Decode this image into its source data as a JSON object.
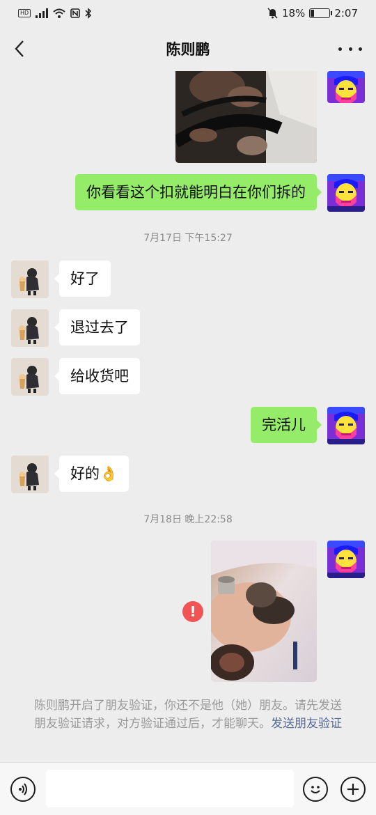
{
  "status_bar": {
    "battery": "18%",
    "time": "2:07",
    "hd": "HD"
  },
  "header": {
    "title": "陈则鹏"
  },
  "messages": [
    {
      "side": "out",
      "text": "你看看这个扣就能明白在你们拆的"
    },
    {
      "timestamp": "7月17日 下午15:27"
    },
    {
      "side": "in",
      "text": "好了"
    },
    {
      "side": "in",
      "text": "退过去了"
    },
    {
      "side": "in",
      "text": "给收货吧"
    },
    {
      "side": "out",
      "text": "完活儿"
    },
    {
      "side": "in",
      "text": "好的👌"
    },
    {
      "timestamp": "7月18日 晚上22:58"
    }
  ],
  "error_mark": "!",
  "notice": {
    "text": "陈则鹏开启了朋友验证，你还不是他（她）朋友。请先发送朋友验证请求，对方验证通过后，才能聊天。",
    "link": "发送朋友验证"
  },
  "input": {
    "placeholder": ""
  },
  "icons": [
    "back-icon",
    "more-icon",
    "voice-icon",
    "emoji-icon",
    "plus-icon",
    "error-icon"
  ],
  "colors": {
    "out_bubble": "#95ec69",
    "in_bubble": "#ffffff",
    "link": "#576b95",
    "error": "#f05454"
  }
}
